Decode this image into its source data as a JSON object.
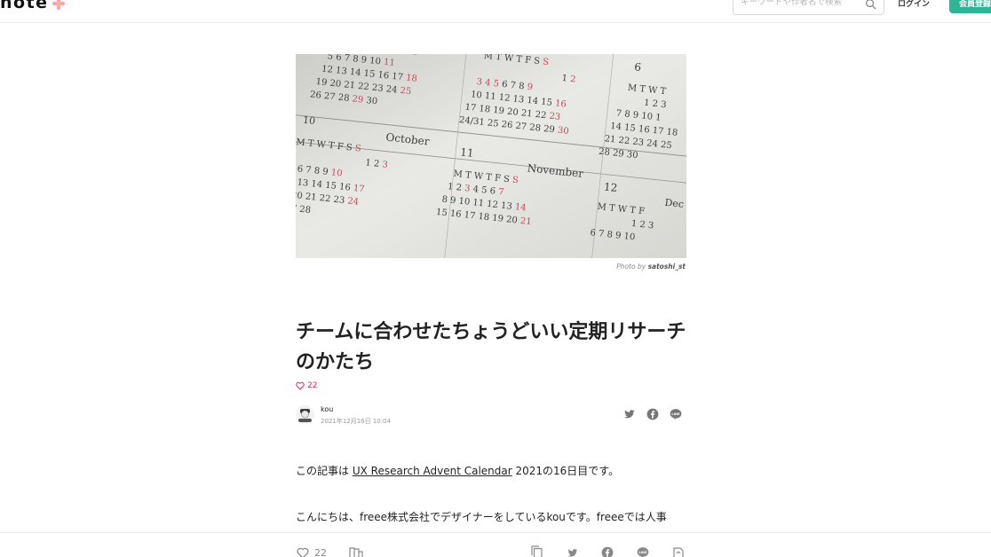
{
  "header": {
    "logo": "note",
    "search_placeholder": "キーワードや作者名で検索",
    "login_label": "ログイン",
    "signup_label": "会員登録"
  },
  "hero": {
    "credit_prefix": "Photo by ",
    "credit_author": "satoshi_st",
    "calendar": {
      "months": [
        "10",
        "October",
        "11",
        "November",
        "12",
        "Dec",
        "6"
      ],
      "weekday_row": "M T W T F S S"
    }
  },
  "article": {
    "title": "チームに合わせたちょうどいい定期リサーチのかたち",
    "like_count": "22",
    "author_name": "kou",
    "date": "2021年12月16日 10:04",
    "para1_prefix": "この記事は ",
    "para1_link": "UX Research Advent Calendar",
    "para1_suffix": " 2021の16日目です。",
    "para2": "こんにちは、freee株式会社でデザイナーをしているkouです。freeeでは人事"
  },
  "bottombar": {
    "like_count": "22"
  },
  "colors": {
    "accent_green": "#2cb696",
    "like_red": "#e0254e",
    "text": "#222222",
    "muted": "#999999"
  }
}
